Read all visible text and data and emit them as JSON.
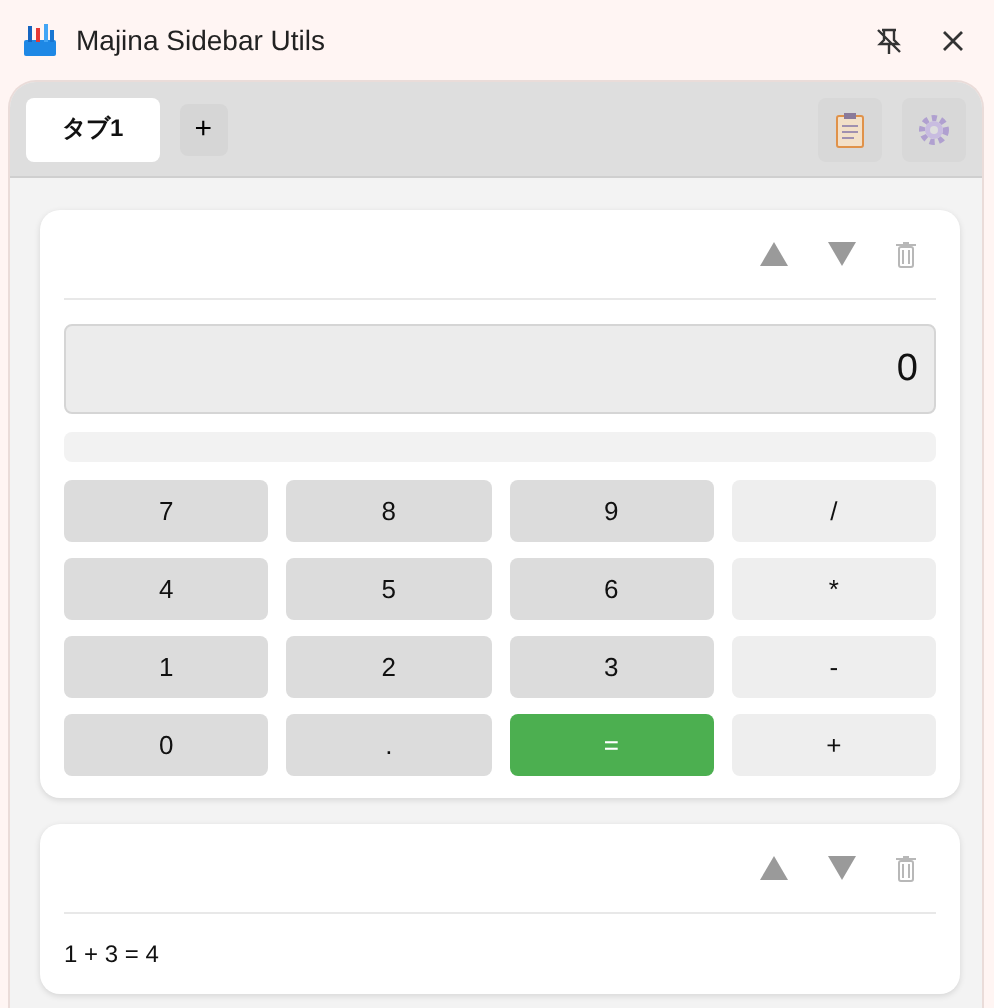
{
  "window": {
    "title": "Majina Sidebar Utils"
  },
  "tabs": [
    {
      "label": "タブ1",
      "selected": true
    }
  ],
  "add_tab": "+",
  "cards": [
    {
      "kind": "calculator",
      "display": "0",
      "keys": [
        {
          "label": "7",
          "kind": "digit"
        },
        {
          "label": "8",
          "kind": "digit"
        },
        {
          "label": "9",
          "kind": "digit"
        },
        {
          "label": "/",
          "kind": "operator"
        },
        {
          "label": "4",
          "kind": "digit"
        },
        {
          "label": "5",
          "kind": "digit"
        },
        {
          "label": "6",
          "kind": "digit"
        },
        {
          "label": "*",
          "kind": "operator"
        },
        {
          "label": "1",
          "kind": "digit"
        },
        {
          "label": "2",
          "kind": "digit"
        },
        {
          "label": "3",
          "kind": "digit"
        },
        {
          "label": "-",
          "kind": "operator"
        },
        {
          "label": "0",
          "kind": "digit"
        },
        {
          "label": ".",
          "kind": "digit"
        },
        {
          "label": "=",
          "kind": "equals"
        },
        {
          "label": "+",
          "kind": "operator"
        }
      ]
    },
    {
      "kind": "history",
      "text": "1 + 3 = 4"
    }
  ]
}
